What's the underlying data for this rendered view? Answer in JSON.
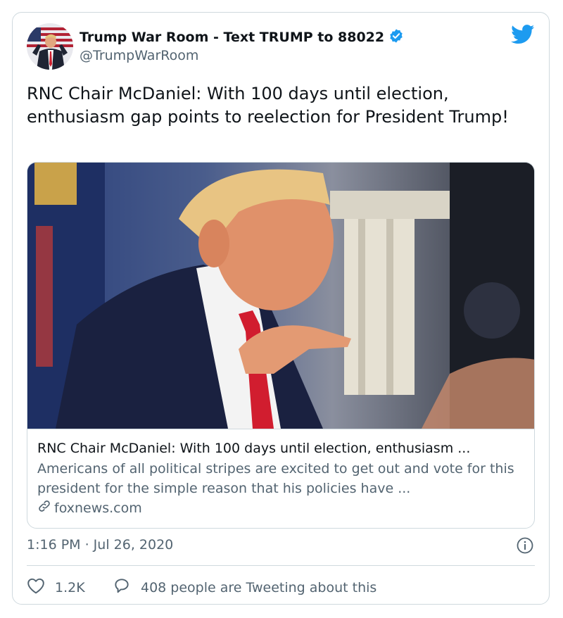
{
  "author": {
    "display_name": "Trump War Room - Text TRUMP to 88022",
    "handle": "@TrumpWarRoom",
    "verified": true
  },
  "tweet": {
    "text": "RNC Chair McDaniel: With 100 days until election, enthusiasm gap points to reelection for President Trump!",
    "timestamp": "1:16 PM · Jul 26, 2020"
  },
  "link_card": {
    "title": "RNC Chair McDaniel: With 100 days until election, enthusiasm ...",
    "description": "Americans of all political stripes are excited to get out and vote for this president for the simple reason that his policies have ...",
    "domain": "foxnews.com"
  },
  "actions": {
    "likes": "1.2K",
    "tweeting_about": "408 people are Tweeting about this"
  },
  "colors": {
    "twitter_blue": "#1d9bf0",
    "text_primary": "#0f1419",
    "text_secondary": "#536471",
    "border": "#cfd9de"
  },
  "icons": [
    "twitter-bird-icon",
    "verified-badge-icon",
    "link-icon",
    "info-icon",
    "heart-icon",
    "reply-bubble-icon"
  ]
}
